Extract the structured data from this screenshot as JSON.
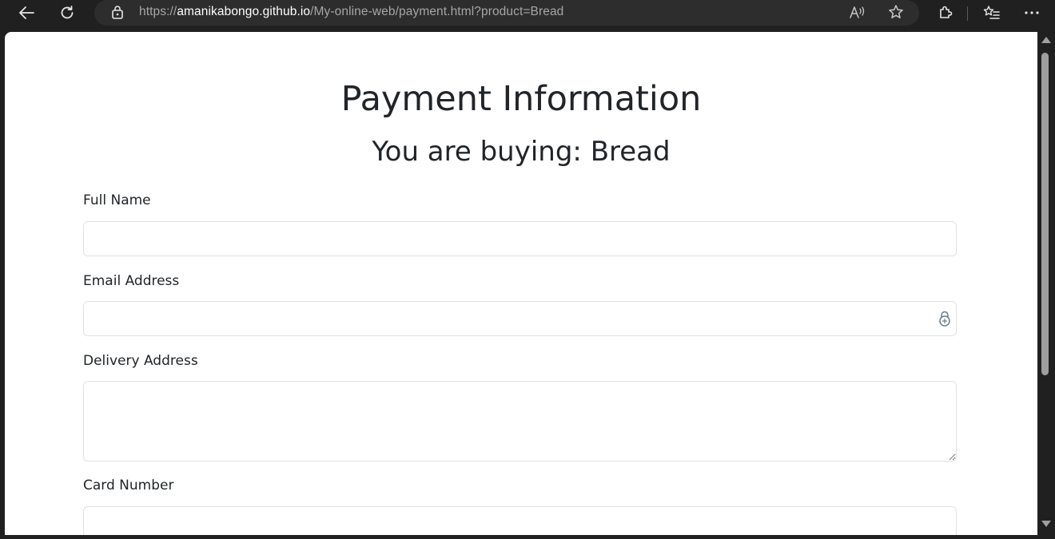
{
  "browser": {
    "url_scheme": "https://",
    "url_host": "amanikabongo.github.io",
    "url_path": "/My-online-web/payment.html?product=Bread"
  },
  "page": {
    "title": "Payment Information",
    "buying_prefix": "You are buying:",
    "product": "Bread"
  },
  "form": {
    "full_name_label": "Full Name",
    "full_name_value": "",
    "email_label": "Email Address",
    "email_value": "",
    "address_label": "Delivery Address",
    "address_value": "",
    "card_label": "Card Number",
    "card_value": ""
  },
  "colors": {
    "toolbar_bg": "#202020",
    "address_bar_bg": "#2d2d2d",
    "text": "#212529",
    "input_border": "#dee2e6"
  },
  "icons": [
    "back-arrow-icon",
    "refresh-icon",
    "lock-icon",
    "read-aloud-icon",
    "favorite-star-icon",
    "extensions-icon",
    "favorites-list-icon",
    "more-options-icon",
    "password-manager-icon"
  ]
}
